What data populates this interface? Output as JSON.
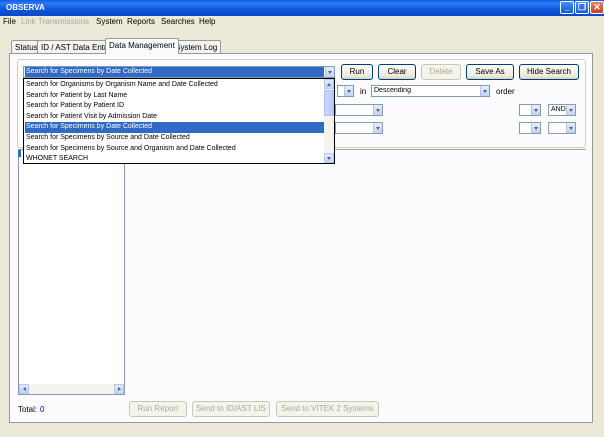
{
  "window": {
    "title": "OBSERVA"
  },
  "menu": {
    "items": [
      {
        "label": "File",
        "enabled": true
      },
      {
        "label": "Link Transmissions",
        "enabled": false
      },
      {
        "label": "System",
        "enabled": true
      },
      {
        "label": "Reports",
        "enabled": true
      },
      {
        "label": "Searches",
        "enabled": true
      },
      {
        "label": "Help",
        "enabled": true
      }
    ]
  },
  "tabs": [
    {
      "label": "Status",
      "active": false
    },
    {
      "label": "ID / AST Data Entry",
      "active": false
    },
    {
      "label": "Data Management",
      "active": true
    },
    {
      "label": "System Log",
      "active": false
    }
  ],
  "search": {
    "selected": "Search for Specimens by Date Collected",
    "options": [
      "Search for Organisms by Organism Name and Date Collected",
      "Search for Patient by Last Name",
      "Search for Patient by Patient ID",
      "Search for Patient Visit by Admission Date",
      "Search for Specimens by Date Collected",
      "Search for Specimens by Source and Date Collected",
      "Search for Specimens by Source and Organism and Date Collected",
      "WHONET SEARCH"
    ],
    "highlighted_index": 4,
    "sort": {
      "in_label": "in",
      "order_value": "Descending",
      "order_label": "order"
    },
    "logic_value": "AND"
  },
  "toolbar": {
    "run": "Run",
    "clear": "Clear",
    "delete": "Delete",
    "save_as": "Save As",
    "hide_search": "Hide Search"
  },
  "footer": {
    "total_label": "Total:",
    "total_value": "0",
    "run_report": "Run Report",
    "send_id_ast": "Send to ID/AST LIS",
    "send_vitek": "Send to VITEK 2 Systems"
  },
  "colors": {
    "titlebar": "#0a5ce8",
    "selection": "#316ac5",
    "face": "#ece9d8"
  }
}
